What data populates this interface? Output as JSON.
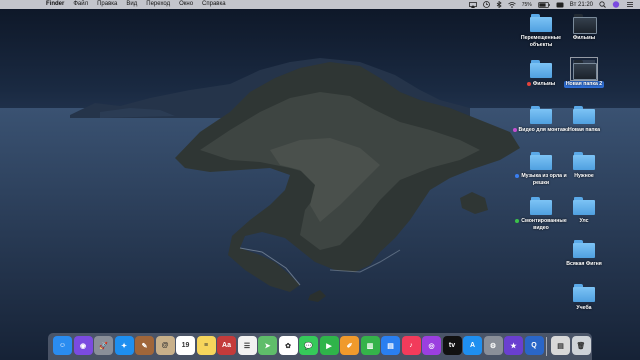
{
  "menubar": {
    "apple_glyph": "",
    "items": [
      "Finder",
      "Файл",
      "Правка",
      "Вид",
      "Переход",
      "Окно",
      "Справка"
    ],
    "clock": "Вт 21:20",
    "battery_level": 0.75
  },
  "desktop": {
    "items": [
      {
        "label": "Перемещенные объекты",
        "tag_color": ""
      },
      {
        "label": "Фильмы",
        "tag_color": "#e2433b"
      },
      {
        "label": "Видео для монтажа",
        "tag_color": "#c54fd1"
      },
      {
        "label": "Музыка из орла и решки",
        "tag_color": "#3a7ff2"
      },
      {
        "label": "Смонтированные видео",
        "tag_color": "#3cc24a"
      },
      {
        "label": "Фильмы",
        "tag_color": ""
      },
      {
        "label": "Новая папка 2",
        "tag_color": "",
        "selected": true
      },
      {
        "label": "Новая папка",
        "tag_color": ""
      },
      {
        "label": "Нужное",
        "tag_color": ""
      },
      {
        "label": "Улс",
        "tag_color": ""
      },
      {
        "label": "Всякая Фигня",
        "tag_color": ""
      },
      {
        "label": "Учеба",
        "tag_color": ""
      }
    ]
  },
  "dock": {
    "apps": [
      {
        "name": "finder-icon",
        "color": "#2a8cf0",
        "glyph": "☺"
      },
      {
        "name": "siri-icon",
        "color": "#7b4be0",
        "glyph": "◉"
      },
      {
        "name": "launchpad-icon",
        "color": "#8a8f99",
        "glyph": "🚀"
      },
      {
        "name": "safari-icon",
        "color": "#1e8ff0",
        "glyph": "✦"
      },
      {
        "name": "notes-brown-icon",
        "color": "#a0663a",
        "glyph": "✎"
      },
      {
        "name": "contacts-icon",
        "color": "#c8b08a",
        "glyph": "@"
      },
      {
        "name": "calendar-icon",
        "color": "#ffffff",
        "glyph": "19"
      },
      {
        "name": "notes-icon",
        "color": "#f6d55c",
        "glyph": "≡"
      },
      {
        "name": "dictionary-icon",
        "color": "#c43b3b",
        "glyph": "Aa"
      },
      {
        "name": "reminders-icon",
        "color": "#f2f2f2",
        "glyph": "☰"
      },
      {
        "name": "maps-icon",
        "color": "#5fbd6a",
        "glyph": "➤"
      },
      {
        "name": "photos-icon",
        "color": "#ffffff",
        "glyph": "✿"
      },
      {
        "name": "messages-icon",
        "color": "#36c95a",
        "glyph": "💬"
      },
      {
        "name": "facetime-icon",
        "color": "#2fb44a",
        "glyph": "▶"
      },
      {
        "name": "pages-icon",
        "color": "#f09a2c",
        "glyph": "✐"
      },
      {
        "name": "numbers-icon",
        "color": "#35b34a",
        "glyph": "▥"
      },
      {
        "name": "keynote-icon",
        "color": "#2a7ff0",
        "glyph": "▤"
      },
      {
        "name": "music-icon",
        "color": "#f23b5b",
        "glyph": "♪"
      },
      {
        "name": "podcasts-icon",
        "color": "#9b3fe0",
        "glyph": "◎"
      },
      {
        "name": "tv-icon",
        "color": "#111111",
        "glyph": "tv"
      },
      {
        "name": "app-store-icon",
        "color": "#1f8ff0",
        "glyph": "A"
      },
      {
        "name": "system-preferences-icon",
        "color": "#8a8f99",
        "glyph": "⚙"
      },
      {
        "name": "imovie-icon",
        "color": "#6a3fd0",
        "glyph": "★"
      },
      {
        "name": "quicktime-icon",
        "color": "#2a66c8",
        "glyph": "Q"
      },
      {
        "name": "downloads-stack-icon",
        "color": "#d8d8d8",
        "glyph": "▤"
      },
      {
        "name": "trash-icon",
        "color": "#cfd3d8",
        "glyph": "🗑"
      }
    ]
  }
}
